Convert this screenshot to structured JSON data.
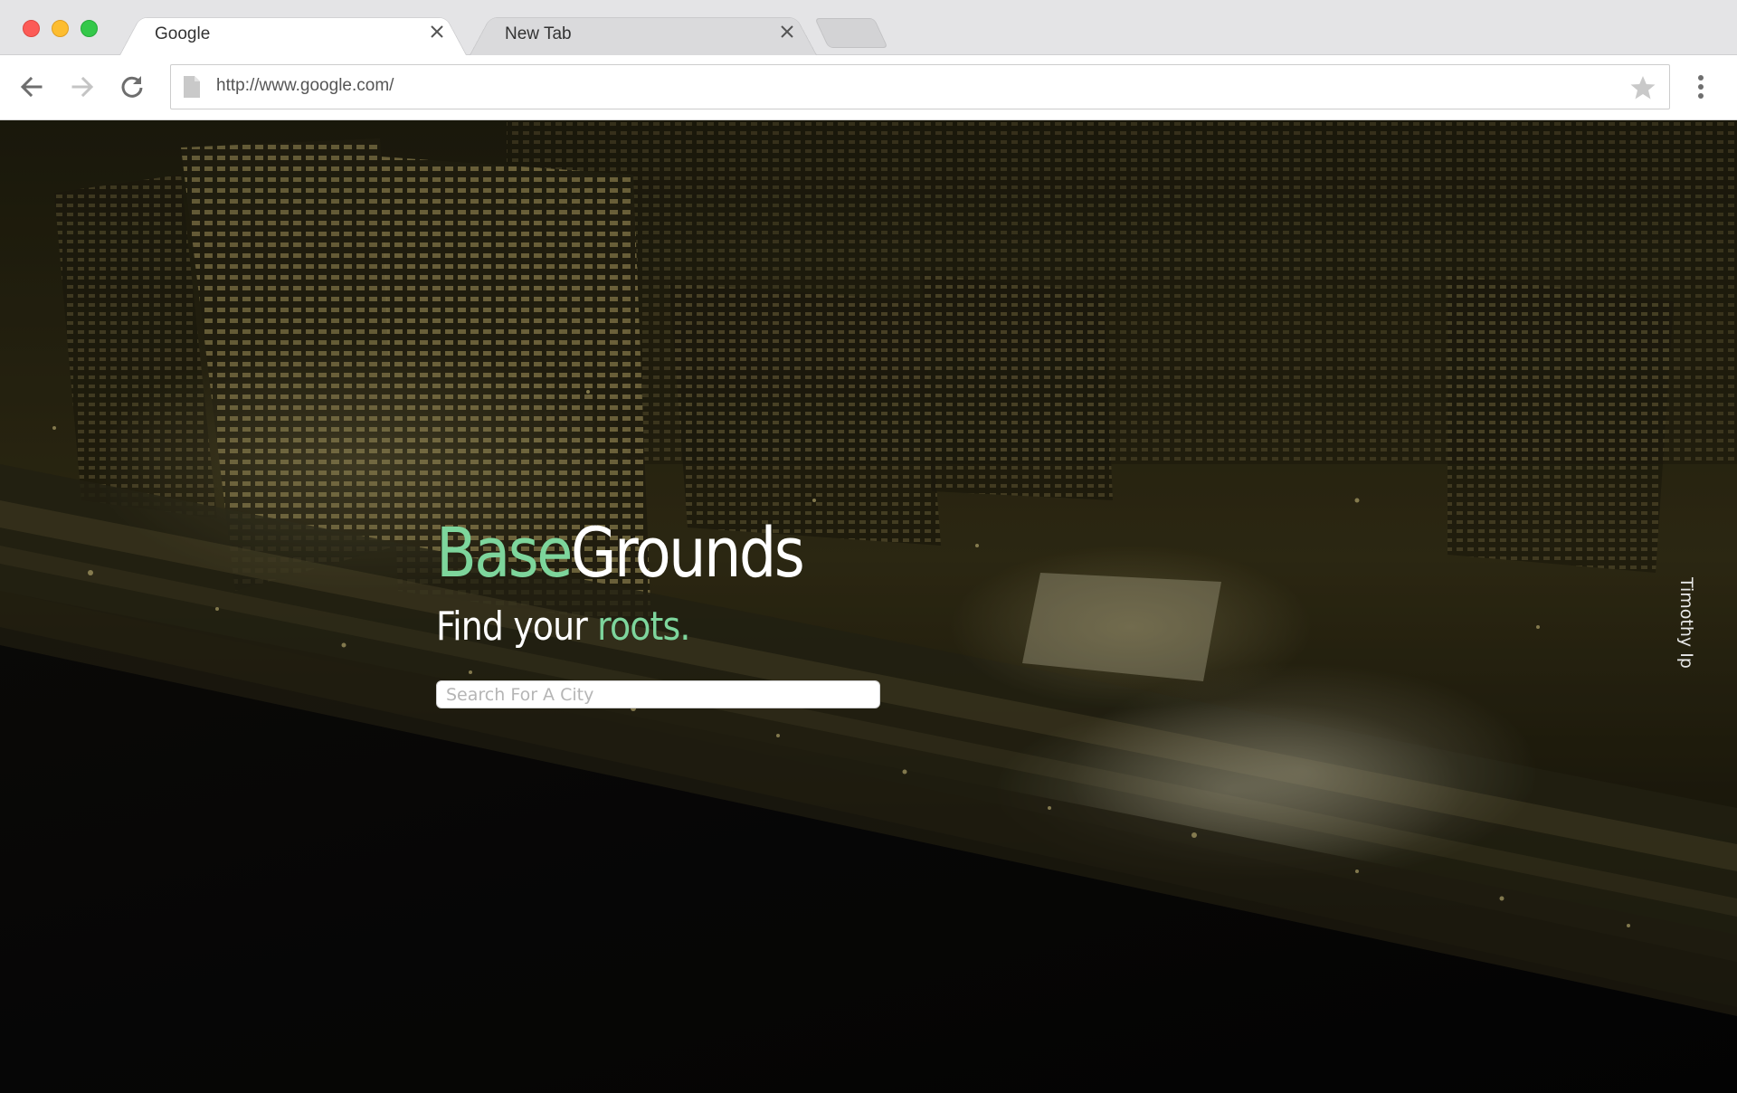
{
  "browser": {
    "tabs": [
      {
        "title": "Google",
        "active": true
      },
      {
        "title": "New Tab",
        "active": false
      }
    ],
    "url": "http://www.google.com/"
  },
  "page": {
    "brand_part1": "Base",
    "brand_part2": "Grounds",
    "tagline_part1": "Find your ",
    "tagline_part2": "roots.",
    "search": {
      "placeholder": "Search For A City",
      "value": ""
    },
    "photo_credit": "Timothy Ip"
  },
  "colors": {
    "accent_green": "#7dd59c",
    "traffic_red": "#fc5b57",
    "traffic_yellow": "#fdbd30",
    "traffic_green": "#34c84a"
  },
  "icons": {
    "back": "arrow-left-icon",
    "forward": "arrow-right-icon",
    "reload": "reload-icon",
    "page": "page-icon",
    "bookmark": "star-icon",
    "menu": "kebab-menu-icon",
    "close_tab": "close-icon"
  }
}
